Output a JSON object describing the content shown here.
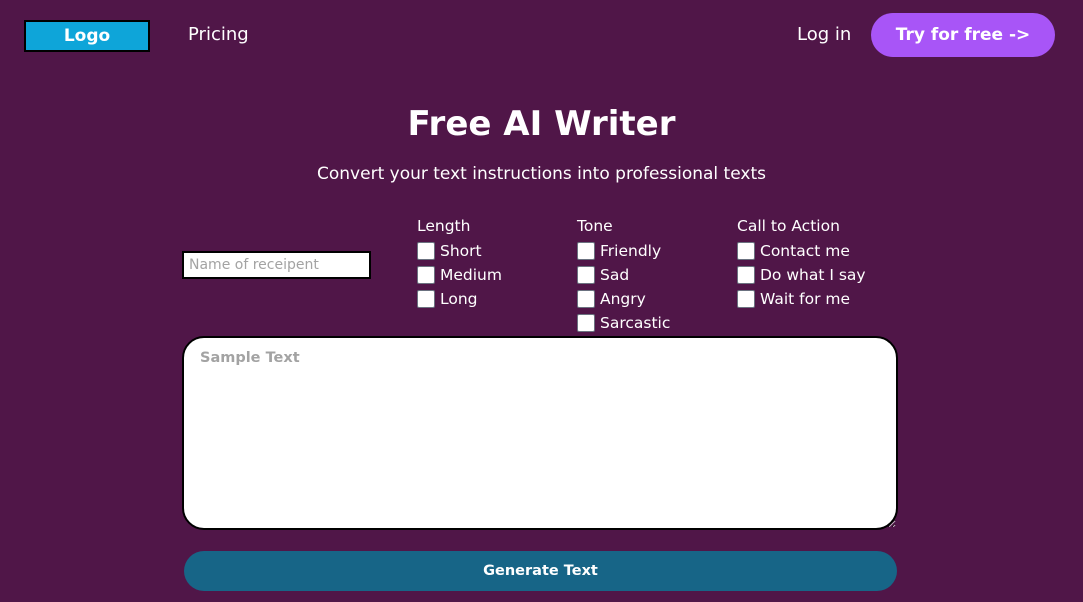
{
  "header": {
    "logo": "Logo",
    "nav_pricing": "Pricing",
    "nav_login": "Log in",
    "cta": "Try for free ->"
  },
  "hero": {
    "title": "Free AI Writer",
    "subtitle": "Convert your text instructions into professional texts"
  },
  "form": {
    "recipient_placeholder": "Name of receipent",
    "recipient_value": "",
    "length": {
      "title": "Length",
      "options": [
        {
          "label": "Short",
          "checked": false
        },
        {
          "label": "Medium",
          "checked": false
        },
        {
          "label": "Long",
          "checked": false
        }
      ]
    },
    "tone": {
      "title": "Tone",
      "options": [
        {
          "label": "Friendly",
          "checked": false
        },
        {
          "label": "Sad",
          "checked": false
        },
        {
          "label": "Angry",
          "checked": false
        },
        {
          "label": "Sarcastic",
          "checked": false
        }
      ]
    },
    "cta_group": {
      "title": "Call to Action",
      "options": [
        {
          "label": "Contact me",
          "checked": false
        },
        {
          "label": "Do what I say",
          "checked": false
        },
        {
          "label": "Wait for me",
          "checked": false
        }
      ]
    },
    "sample_placeholder": "Sample Text",
    "generate_label": "Generate Text"
  },
  "colors": {
    "background": "#501648",
    "logo_bg": "#0ea5d9",
    "cta_bg": "#a855f7",
    "generate_bg": "#176587"
  }
}
